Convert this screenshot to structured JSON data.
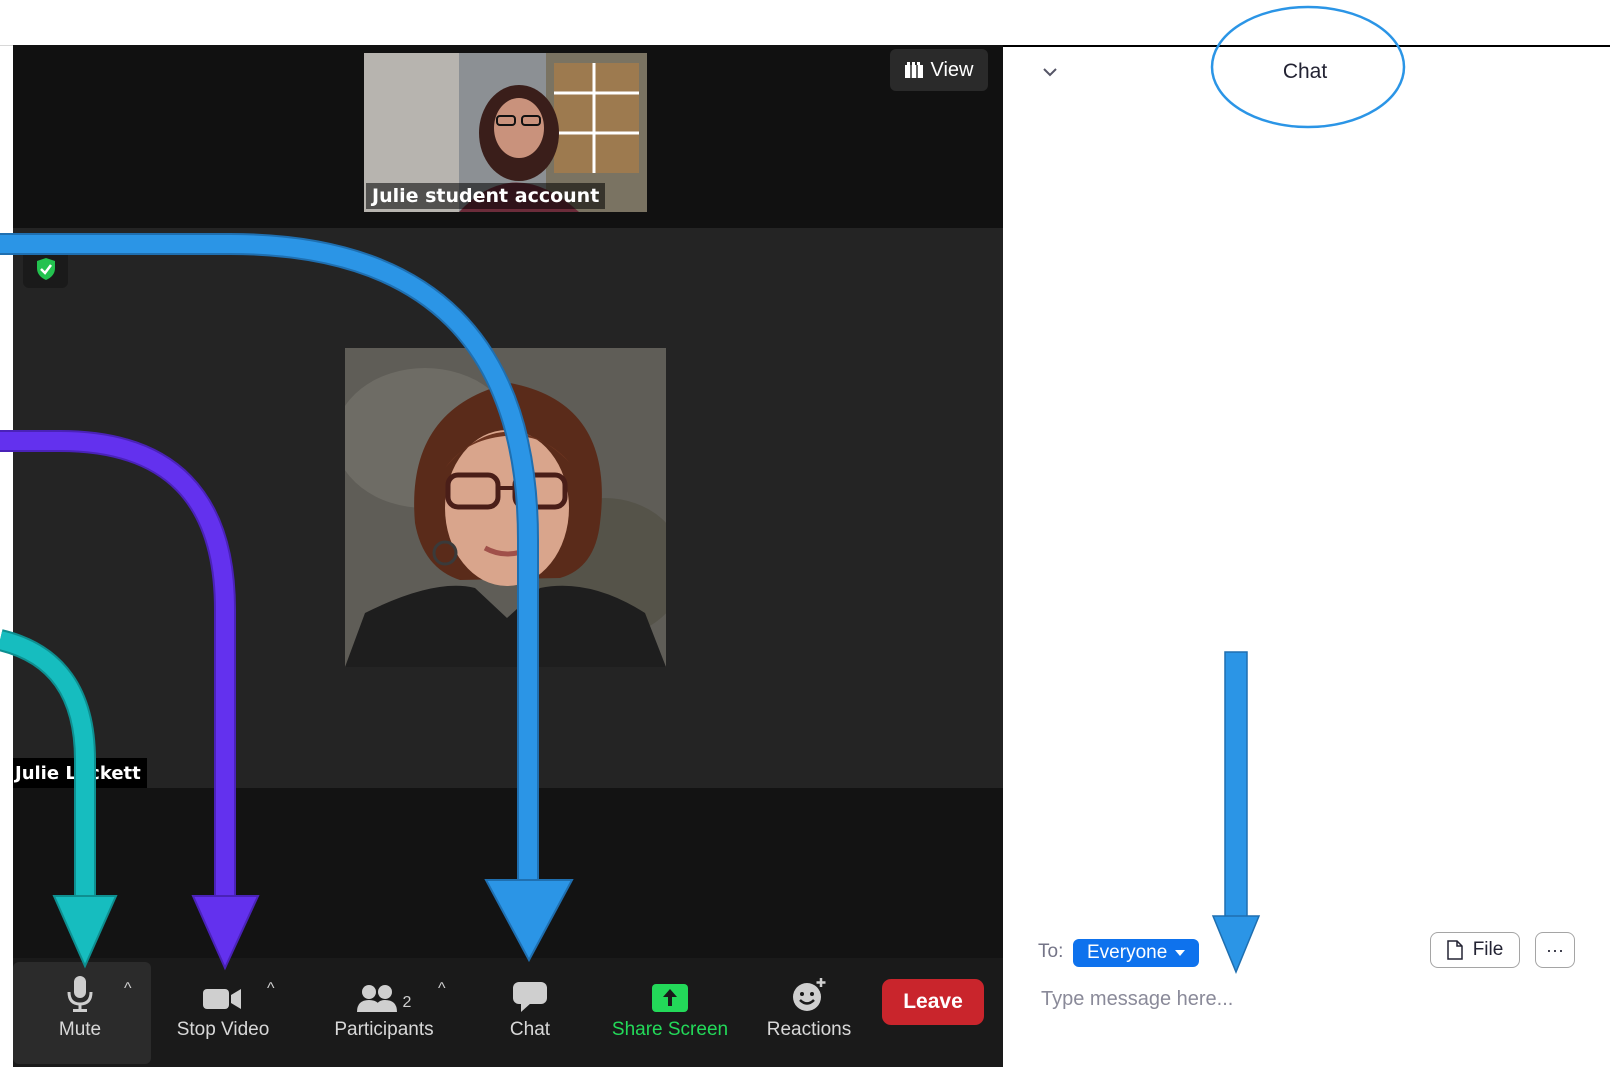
{
  "meeting": {
    "view_label": "View",
    "thumbnail_name": "Julie student account",
    "speaker_name": "Julie Lockett"
  },
  "toolbar": {
    "mute_label": "Mute",
    "stop_video_label": "Stop Video",
    "participants_label": "Participants",
    "participants_count": "2",
    "chat_label": "Chat",
    "share_screen_label": "Share Screen",
    "reactions_label": "Reactions",
    "leave_label": "Leave"
  },
  "chat_panel": {
    "title": "Chat",
    "to_label": "To:",
    "recipient": "Everyone",
    "file_label": "File",
    "more_label": "···",
    "message_placeholder": "Type message here..."
  },
  "colors": {
    "share_green": "#23d959",
    "leave_red": "#c9252c",
    "recipient_blue": "#0e72ed",
    "arrow_blue": "#2b95e6",
    "arrow_purple": "#6331ee",
    "arrow_teal": "#16bdbf"
  }
}
